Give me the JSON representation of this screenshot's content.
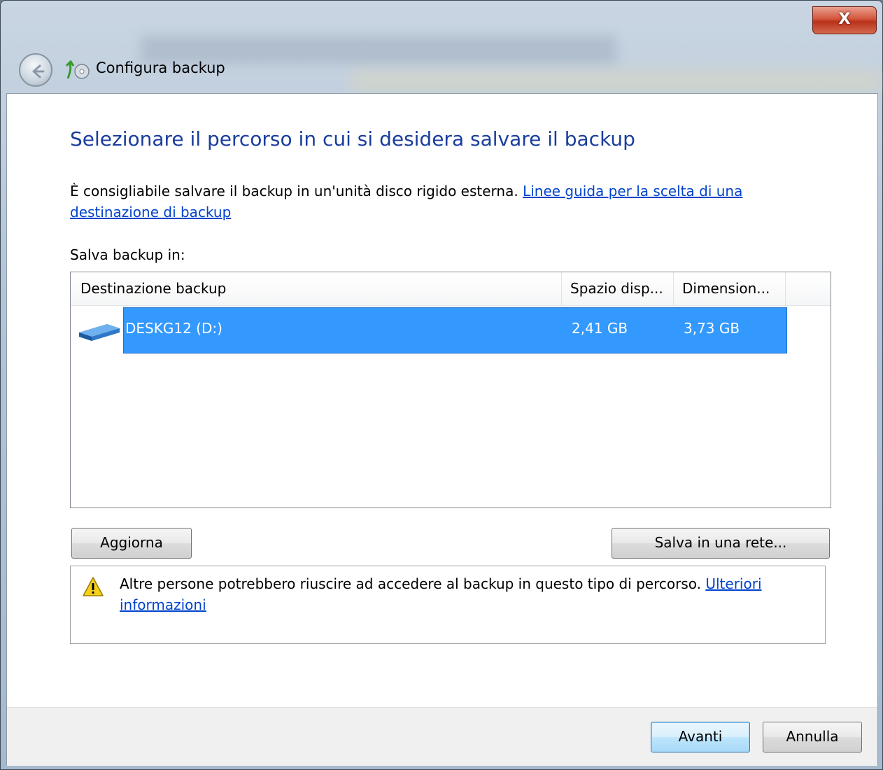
{
  "window": {
    "title": "Configura backup",
    "close_label": "X"
  },
  "main": {
    "heading": "Selezionare il percorso in cui si desidera salvare il backup",
    "description": "È consigliabile salvare il backup in un'unità disco rigido esterna.",
    "guide_link": "Linee guida per la scelta di una destinazione di backup",
    "save_label": "Salva backup in:"
  },
  "table": {
    "columns": [
      "Destinazione backup",
      "Spazio disp...",
      "Dimension..."
    ],
    "rows": [
      {
        "name": "DESKG12 (D:)",
        "free": "2,41 GB",
        "size": "3,73 GB",
        "icon": "drive-icon",
        "selected": true
      }
    ]
  },
  "buttons": {
    "refresh": "Aggiorna",
    "save_network": "Salva in una rete...",
    "next": "Avanti",
    "cancel": "Annulla"
  },
  "warning": {
    "text": "Altre persone potrebbero riuscire ad accedere al backup in questo tipo di percorso.",
    "link": "Ulteriori informazioni"
  },
  "colors": {
    "heading": "#1a3d9c",
    "selection": "#3399ff",
    "link": "#0044cc"
  }
}
